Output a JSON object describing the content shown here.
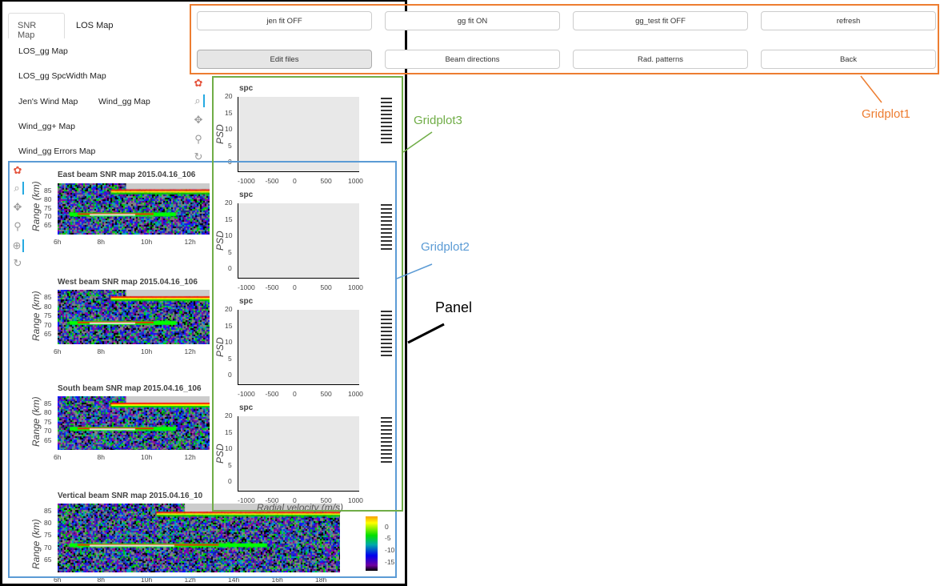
{
  "tabs": [
    {
      "label": "SNR Map",
      "active": true
    },
    {
      "label": "LOS Map"
    }
  ],
  "links": [
    "LOS_gg Map",
    "LOS_gg SpcWidth Map",
    "Jen's Wind Map",
    "Wind_gg Map",
    "Wind_gg+ Map",
    "Wind_gg Errors Map"
  ],
  "buttons": [
    {
      "label": "jen fit OFF"
    },
    {
      "label": "gg fit ON"
    },
    {
      "label": "gg_test fit OFF"
    },
    {
      "label": "refresh"
    },
    {
      "label": "Edit files",
      "pressed": true
    },
    {
      "label": "Beam directions"
    },
    {
      "label": "Rad. patterns"
    },
    {
      "label": "Back"
    }
  ],
  "annotations": {
    "gridplot1": "Gridplot1",
    "gridplot2": "Gridplot2",
    "gridplot3": "Gridplot3",
    "panel": "Panel",
    "colors": {
      "gridplot1": "#ed7d31",
      "gridplot2": "#5b9bd5",
      "gridplot3": "#70ad47",
      "panel": "#000000"
    }
  },
  "snr_maps": {
    "ylabel": "Range (km)",
    "yticks": [
      "85",
      "80",
      "75",
      "70",
      "65"
    ],
    "xticks_short": [
      "6h",
      "8h",
      "10h",
      "12h"
    ],
    "xticks_long": [
      "6h",
      "8h",
      "10h",
      "12h",
      "14h",
      "16h",
      "18h"
    ],
    "titles": [
      "East beam SNR map 2015.04.16_106",
      "West beam SNR map 2015.04.16_106",
      "South beam SNR map 2015.04.16_106",
      "Vertical beam SNR map 2015.04.16_10"
    ],
    "colorbar_ticks": [
      "0",
      "-5",
      "-10",
      "-15"
    ]
  },
  "spc_plots": {
    "title": "spc",
    "ylabel": "PSD",
    "xlabel": "Radial velocity (m/s)",
    "yticks": [
      "20",
      "15",
      "10",
      "5",
      "0"
    ],
    "xticks": [
      "-1000",
      "-500",
      "0",
      "500",
      "1000"
    ],
    "ylim": [
      -2,
      20
    ],
    "xlim": [
      -1100,
      1100
    ]
  }
}
